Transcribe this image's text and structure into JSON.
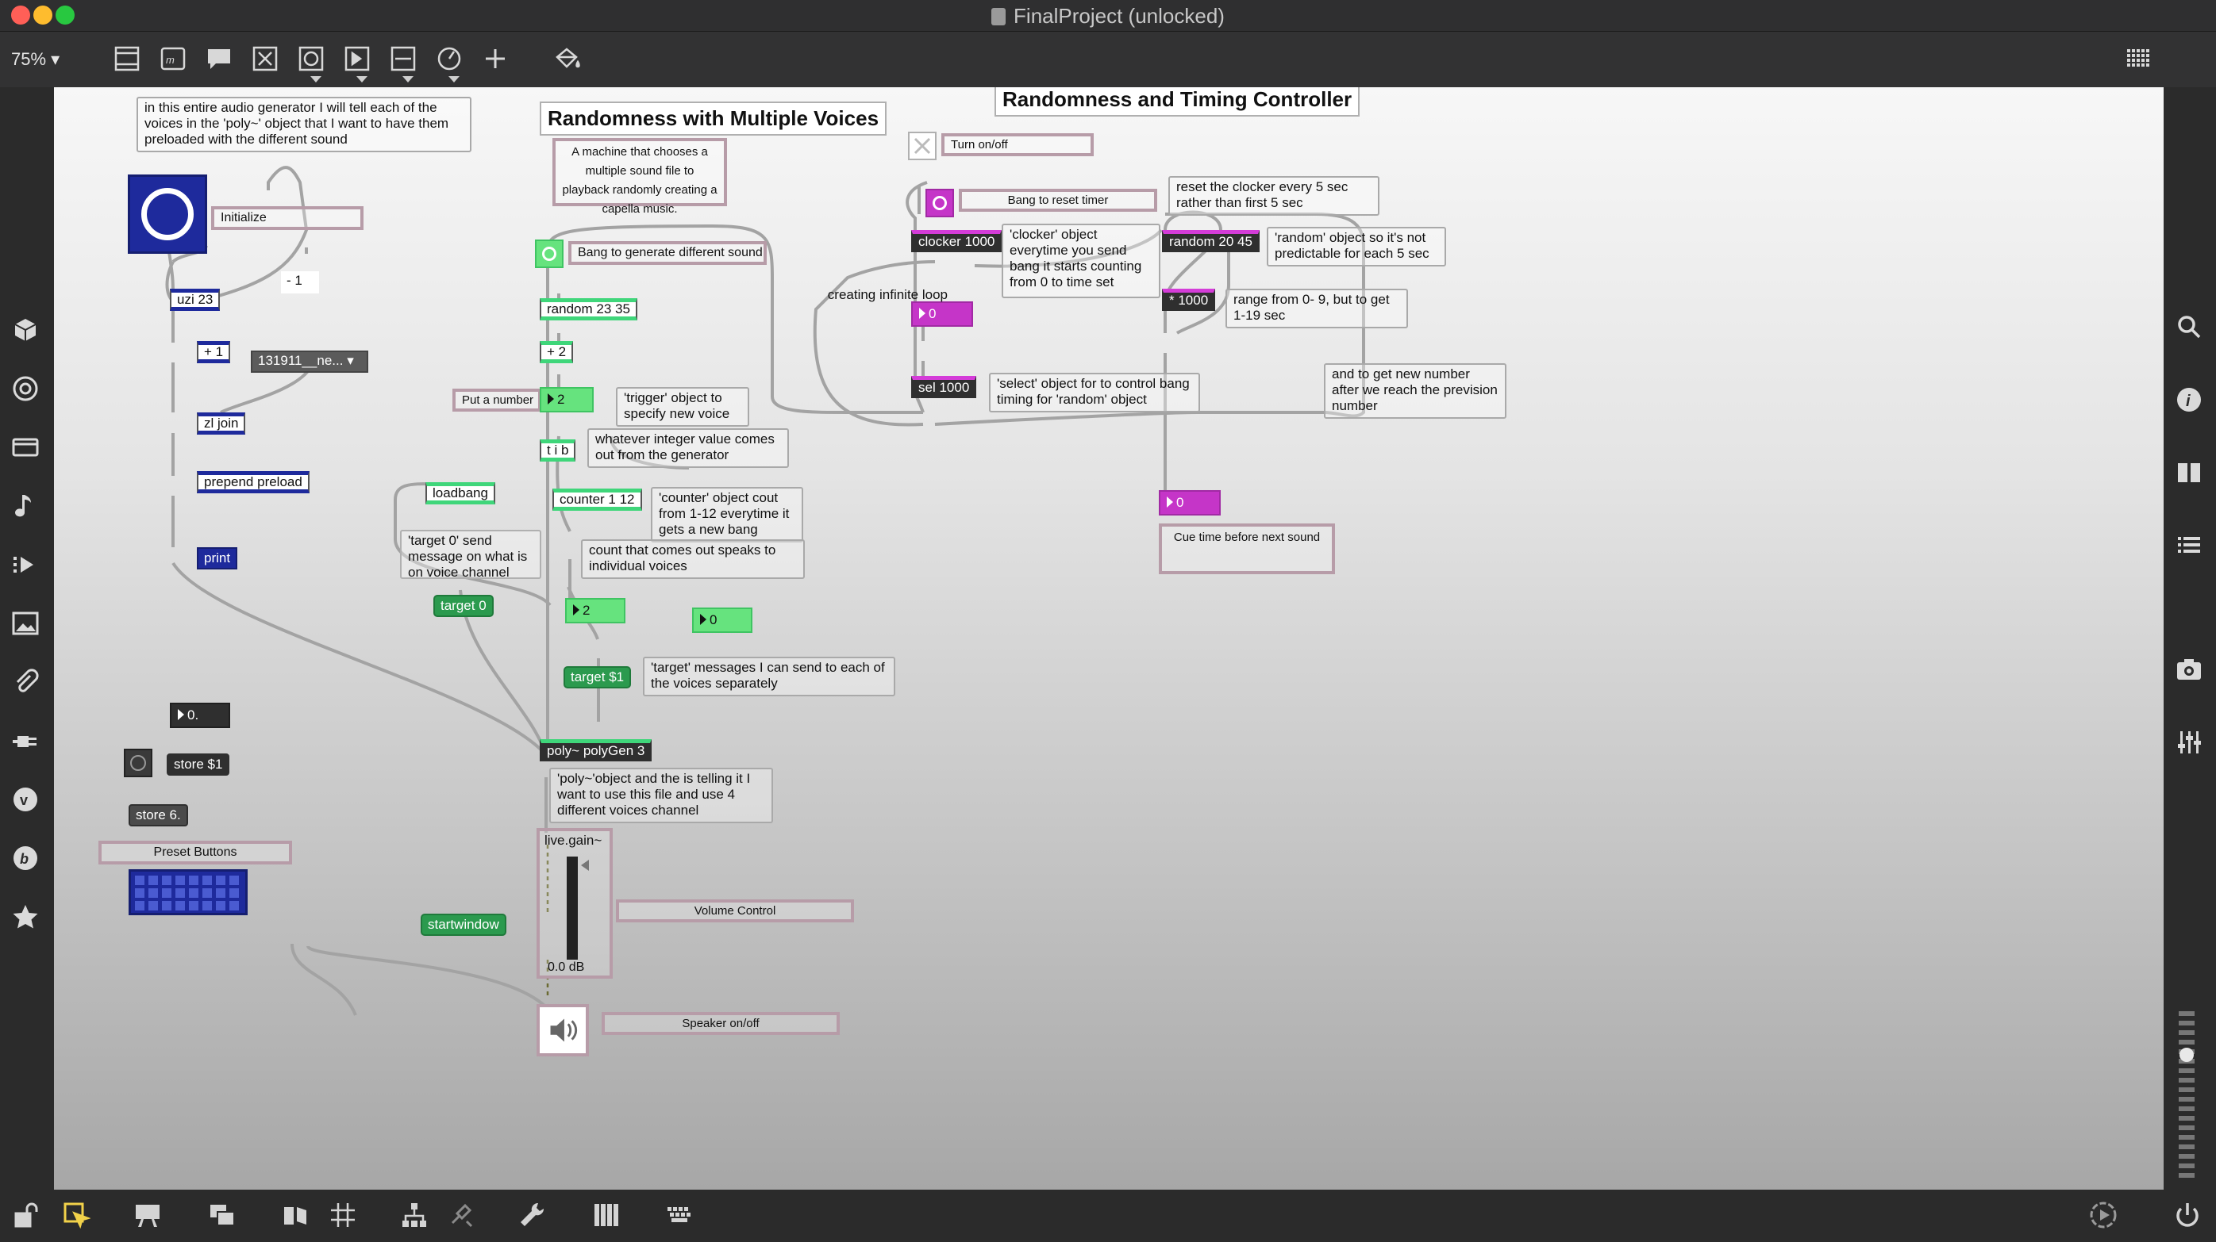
{
  "window": {
    "title": "FinalProject (unlocked)",
    "zoom": "75%"
  },
  "traffic_lights": {
    "close": "#ff5f57",
    "minimize": "#febc2e",
    "maximize": "#28c840"
  },
  "toolbar_icons": [
    "new-object-icon",
    "message-icon",
    "comment-icon",
    "toggle-icon",
    "button-icon",
    "number-icon",
    "slider-icon",
    "dial-icon",
    "add-icon",
    "paint-bucket-icon",
    "grid-icon"
  ],
  "left_sidebar_icons": [
    "cube-icon",
    "target-icon",
    "film-icon",
    "note-icon",
    "play-steps-icon",
    "image-icon",
    "paperclip-icon",
    "plug-icon",
    "vimeo-icon",
    "b-icon",
    "star-icon"
  ],
  "right_sidebar_icons": [
    "search-icon",
    "info-icon",
    "columns-icon",
    "list-icon",
    "camera-icon",
    "mixer-icon"
  ],
  "bottom_icons": [
    "lock-icon",
    "pointer-icon",
    "presentation-icon",
    "windows-icon",
    "shapes-icon",
    "grid-icon",
    "hierarchy-icon",
    "debug-icon",
    "wrench-icon",
    "piano-icon",
    "keyboard-icon",
    "play-circle-icon",
    "power-icon"
  ],
  "colors": {
    "green_object": "#2b9a4e",
    "green_number": "#66e37e",
    "magenta_number": "#c535c8",
    "blue_button": "#1e2a9c"
  },
  "headers": {
    "voices": "Randomness with Multiple Voices",
    "timing": "Randomness and Timing Controller"
  },
  "comments": {
    "intro": "in this entire audio generator I will tell each of the voices in the 'poly~' object that I want to have them preloaded with the different  sound",
    "initialize": "Initialize",
    "machine": "A machine that chooses a multiple sound file to playback randomly creating a capella music.",
    "bang_generate": "Bang to generate different sound",
    "put_number": "Put a number",
    "trigger": "'trigger' object to specify new voice",
    "integer_value": "whatever integer value comes out from the generator",
    "counter": "'counter' object cout from 1-12 everytime it gets a new bang",
    "count_voices": "count that comes out speaks to individual voices",
    "target0_desc": "'target 0' send message on what is on voice channel",
    "target_messages": "'target' messages I can send to  each of the voices separately",
    "poly_desc": "'poly~'object and the is telling it I want to use this file and use 4 different voices channel",
    "volume": "Volume Control",
    "speaker": "Speaker on/off",
    "preset_buttons": "Preset Buttons",
    "creating_loop": "creating infinite loop",
    "turn_onoff": "Turn on/off",
    "bang_reset": "Bang to reset timer",
    "clocker_desc": "'clocker' object everytime you send bang it starts counting from 0 to time set",
    "reset_clocker": "reset the clocker every 5 sec rather than first 5 sec",
    "random_desc": "'random' object so it's not predictable for each 5 sec",
    "range_desc": "range from 0- 9, but to get 1-19 sec",
    "select_desc": "'select' object for to control bang timing for 'random' object",
    "new_number": "and to get new number after we reach the prevision number",
    "cue_time": "Cue time before next sound"
  },
  "objects": {
    "uzi": "uzi 23",
    "minus1": "- 1",
    "plus1": "+ 1",
    "menu": "131911__ne...",
    "zljoin": "zl join",
    "prepend": "prepend preload",
    "print": "print",
    "loadbang": "loadbang",
    "target0": "target 0",
    "random_voices": "random 23 35",
    "plus2": "+ 2",
    "tib": "t i b",
    "counter": "counter 1 12",
    "target_var": "target $1",
    "poly": "poly~ polyGen 3",
    "livegain": "live.gain~",
    "gain_value": "0.0 dB",
    "startwindow": "startwindow",
    "store_var": "store $1",
    "store_val": "store 6.",
    "clocker": "clocker 1000",
    "random_timing": "random 20 45",
    "mult": "* 1000",
    "sel": "sel 1000"
  },
  "numbers": {
    "put_number": "2",
    "count_out": "2",
    "count_b": "0",
    "float_box": "0.",
    "clocker_out": "0",
    "cue_out": "0"
  }
}
